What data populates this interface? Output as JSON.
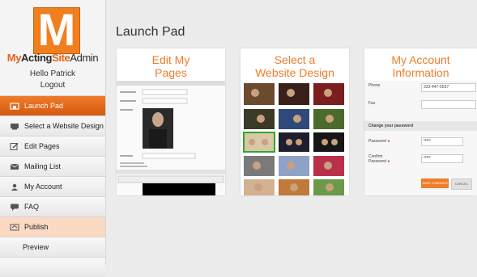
{
  "logo": {
    "letter": "M",
    "part1": "My",
    "part2": "Acting",
    "part3": "Site",
    "part4": "Admin"
  },
  "user": {
    "greeting": "Hello Patrick",
    "logout": "Logout"
  },
  "nav": [
    {
      "label": "Launch Pad",
      "icon": "home-icon"
    },
    {
      "label": "Select a Website Design",
      "icon": "monitor-icon"
    },
    {
      "label": "Edit Pages",
      "icon": "edit-icon"
    },
    {
      "label": "Mailing List",
      "icon": "envelope-icon"
    },
    {
      "label": "My Account",
      "icon": "user-icon"
    },
    {
      "label": "FAQ",
      "icon": "chat-icon"
    },
    {
      "label": "Publish",
      "icon": "publish-icon"
    },
    {
      "label": "Preview",
      "icon": ""
    }
  ],
  "page": {
    "title": "Launch Pad"
  },
  "cards": [
    {
      "title_l1": "Edit My",
      "title_l2": "Pages"
    },
    {
      "title_l1": "Select a",
      "title_l2": "Website Design"
    },
    {
      "title_l1": "My Account",
      "title_l2": "Information"
    }
  ],
  "account_form": {
    "phone_label": "Phone",
    "phone_value": "323-447-5567",
    "fax_label": "Fax",
    "change_pw": "Change your password",
    "password_label": "Password",
    "password_value": "•••••",
    "confirm_label_1": "Confirm",
    "confirm_label_2": "Password",
    "confirm_value": "•••••",
    "save": "SAVE CHANGES",
    "cancel": "CANCEL"
  },
  "colors": {
    "accent": "#ef7c2a",
    "publish_bg": "#fbd9c3"
  }
}
